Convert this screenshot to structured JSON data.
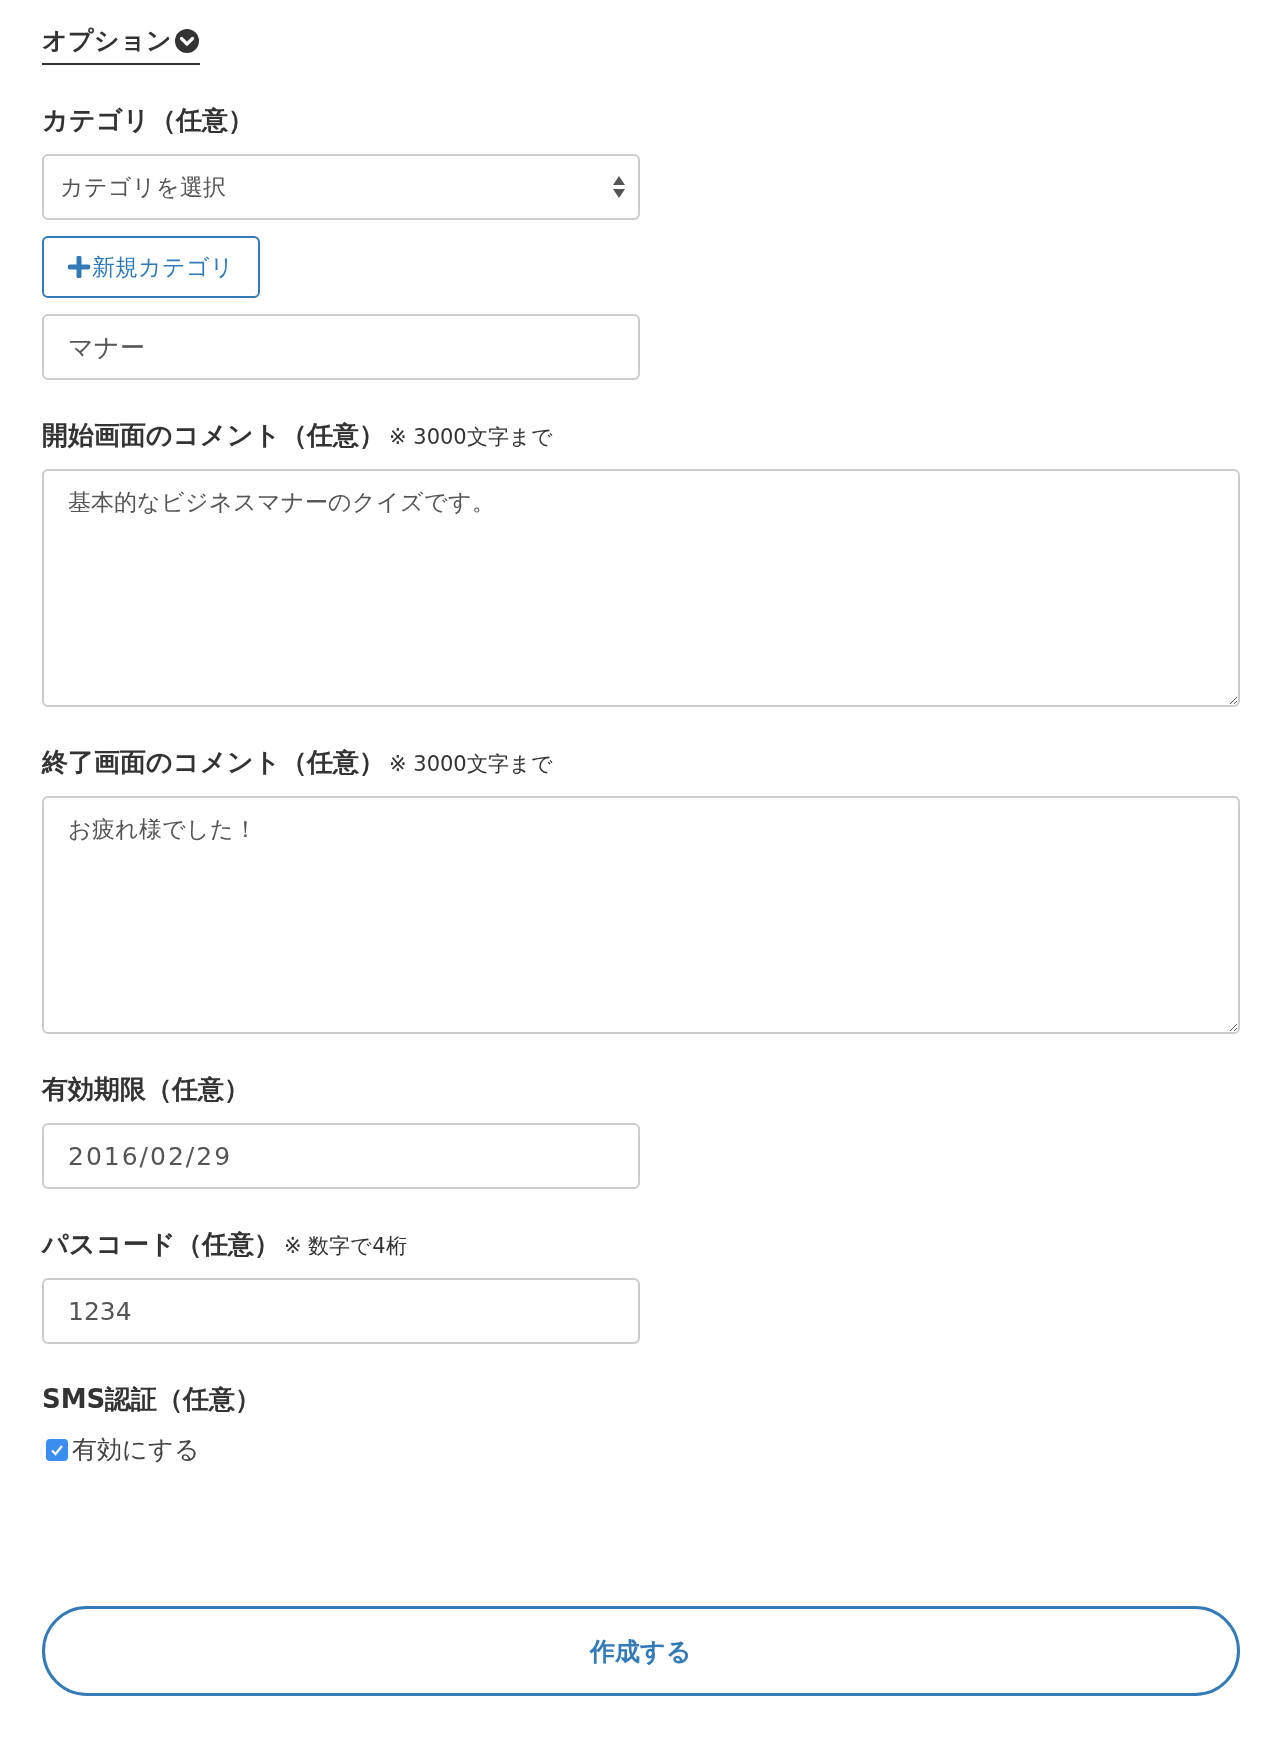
{
  "section_toggle": {
    "label": "オプション",
    "expanded": true
  },
  "groups": [
    {
      "label": "カテゴリ（任意）",
      "controls": [
        {
          "kind": "select",
          "value": "カテゴリを選択"
        },
        {
          "kind": "button",
          "label": "新規カテゴリ"
        },
        {
          "kind": "text",
          "value": "マナー"
        }
      ]
    },
    {
      "label": "開始画面のコメント（任意）",
      "note": "※ 3000文字まで",
      "controls": [
        {
          "kind": "textarea",
          "value": "基本的なビジネスマナーのクイズです。"
        }
      ]
    },
    {
      "label": "終了画面のコメント（任意）",
      "note": "※ 3000文字まで",
      "controls": [
        {
          "kind": "textarea",
          "value": "お疲れ様でした！"
        }
      ]
    },
    {
      "label": "有効期限（任意）",
      "controls": [
        {
          "kind": "date",
          "value": "2016/02/29"
        }
      ]
    },
    {
      "label": "パスコード（任意）",
      "note": "※ 数字で4桁",
      "controls": [
        {
          "kind": "text",
          "value": "1234"
        }
      ]
    },
    {
      "label": "SMS認証（任意）",
      "controls": [
        {
          "kind": "checkbox",
          "label": "有効にする",
          "checked": true
        }
      ]
    }
  ],
  "submit": {
    "label": "作成する"
  }
}
